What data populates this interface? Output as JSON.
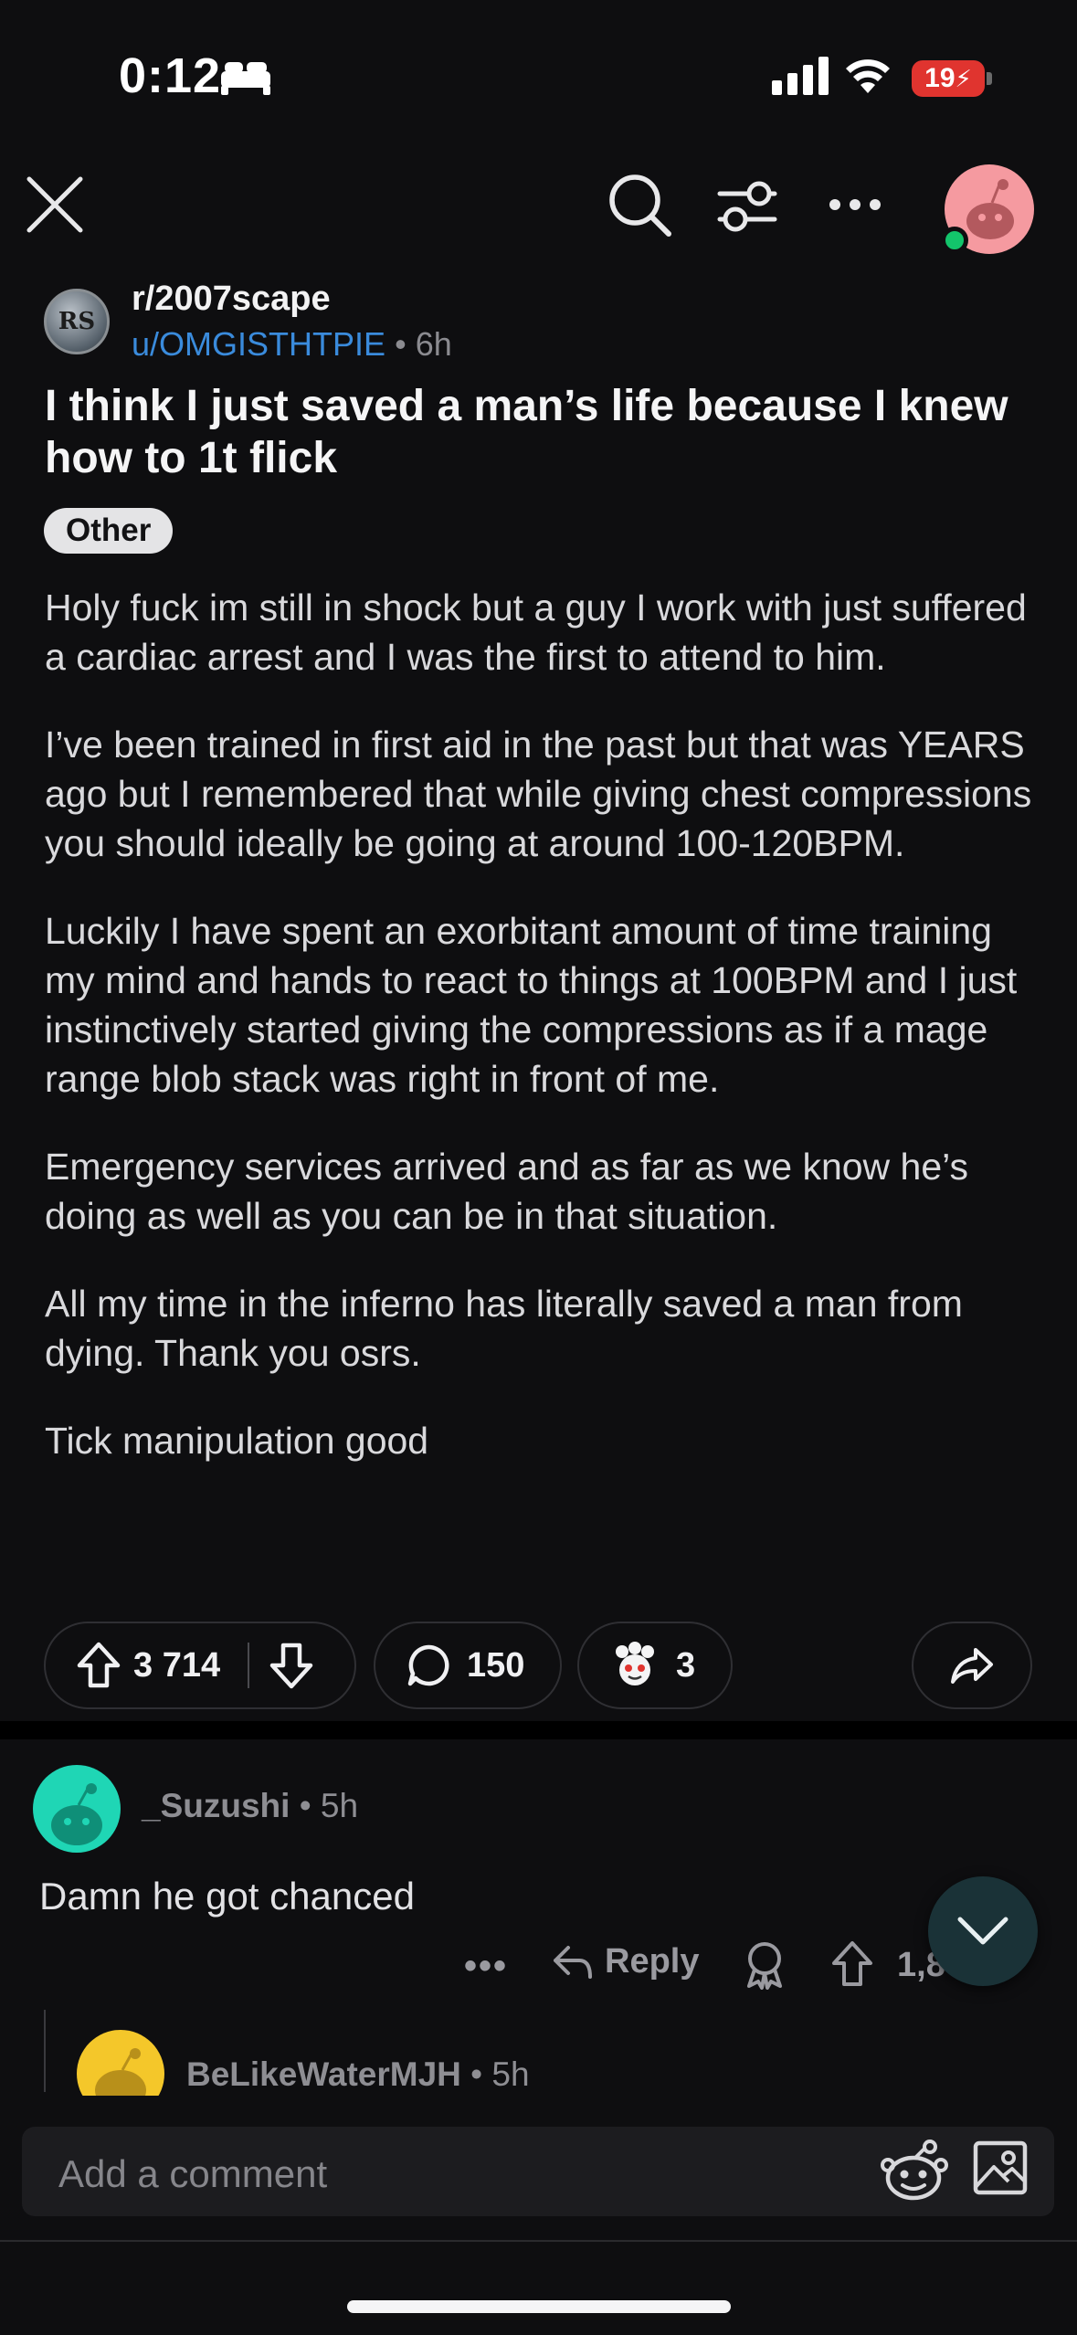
{
  "status_bar": {
    "time": "0:12",
    "battery": "19"
  },
  "header": {
    "close_icon": "close-icon",
    "search_icon": "search-icon",
    "filter_icon": "filter-icon",
    "more_icon": "more-icon"
  },
  "post": {
    "subreddit": "r/2007scape",
    "author": "u/OMGISTHTPIE",
    "separator": "•",
    "age": "6h",
    "title": "I think I just saved a man’s life because I knew how to 1t flick",
    "flair": "Other",
    "paragraphs": [
      "Holy fuck im still in shock but a guy I work with just suffered a cardiac arrest and I was the first to attend to him.",
      "I’ve been trained in first aid in the past but that was YEARS ago but I remembered that while giving chest compressions you should ideally be going at around 100-120BPM.",
      "Luckily I have spent an exorbitant amount of time training my mind and hands to react to things at 100BPM and I just instinctively started giving the compressions as if a mage range blob stack was right in front of me.",
      "Emergency services arrived and as far as we know he’s doing as well as you can be in that situation.",
      "All my time in the inferno has literally saved a man from dying. Thank you osrs.",
      "Tick manipulation good"
    ],
    "upvotes": "3 714",
    "comments": "150",
    "awards": "3"
  },
  "comment": {
    "author": "_Suzushi",
    "age": "• 5h",
    "text": "Damn he got chanced",
    "more": "•••",
    "reply_label": "Reply",
    "score": "1,8"
  },
  "reply": {
    "author": "BeLikeWaterMJH",
    "age": "• 5h"
  },
  "composer": {
    "placeholder": "Add a comment"
  },
  "colors": {
    "background": "#0e0e10",
    "link": "#3a8bdc",
    "online": "#13c46b",
    "battery": "#e0342f"
  }
}
